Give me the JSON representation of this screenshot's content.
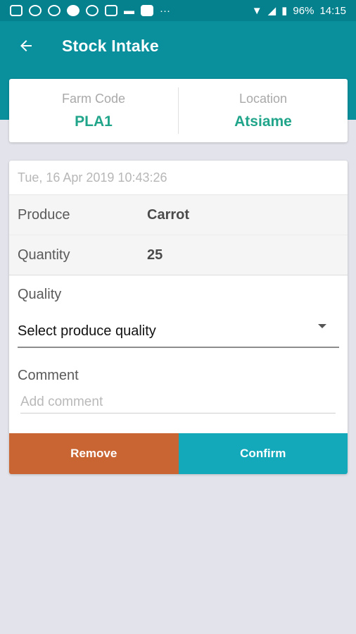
{
  "status_bar": {
    "battery": "96%",
    "time": "14:15",
    "icons": [
      "app-notification-icon",
      "message-icon",
      "message-icon",
      "team-icon",
      "message-icon",
      "mail-icon",
      "dash-icon",
      "image-icon",
      "more-dots",
      "wifi-icon",
      "signal-icon",
      "battery-icon"
    ]
  },
  "app_bar": {
    "title": "Stock Intake",
    "back_icon": "arrow-left-icon"
  },
  "info": {
    "farm_code_label": "Farm Code",
    "farm_code_value": "PLA1",
    "location_label": "Location",
    "location_value": "Atsiame"
  },
  "form": {
    "timestamp": "Tue, 16 Apr 2019 10:43:26",
    "produce_label": "Produce",
    "produce_value": "Carrot",
    "quantity_label": "Quantity",
    "quantity_value": "25",
    "quality_label": "Quality",
    "quality_select": "Select produce quality",
    "comment_label": "Comment",
    "comment_placeholder": "Add comment"
  },
  "actions": {
    "remove_label": "Remove",
    "confirm_label": "Confirm"
  },
  "colors": {
    "primary": "#0a8f9c",
    "accent_text": "#20a48a",
    "remove": "#c96433",
    "confirm": "#14a8bb",
    "background": "#e3e3eb"
  }
}
